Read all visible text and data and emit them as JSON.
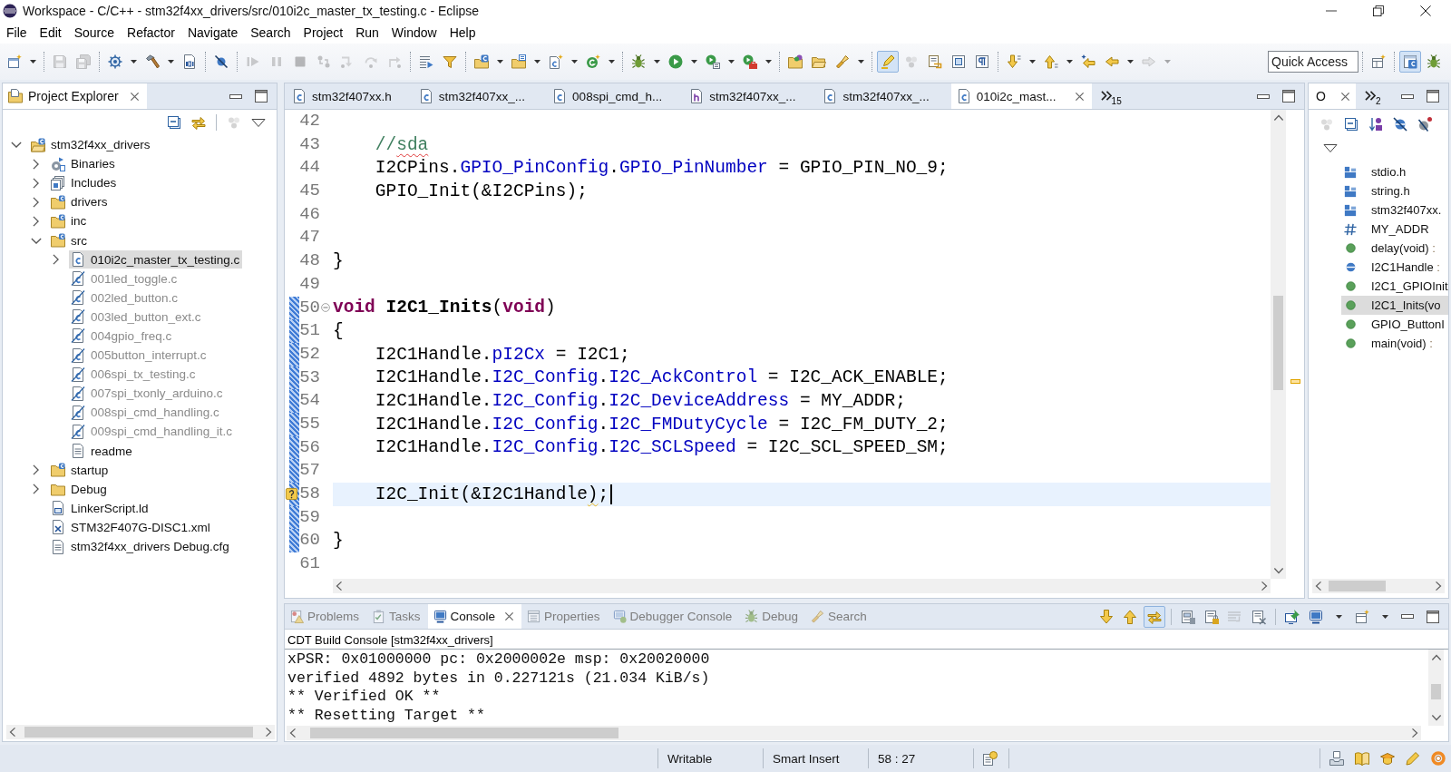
{
  "window": {
    "title": "Workspace - C/C++ - stm32f4xx_drivers/src/010i2c_master_tx_testing.c - Eclipse"
  },
  "menu": [
    "File",
    "Edit",
    "Source",
    "Refactor",
    "Navigate",
    "Search",
    "Project",
    "Run",
    "Window",
    "Help"
  ],
  "toolbar": {
    "groups": [
      [
        {
          "kind": "wizard",
          "dropdown": true,
          "disabled": false
        }
      ],
      [
        {
          "kind": "save",
          "disabled": true
        },
        {
          "kind": "saveall",
          "disabled": true
        }
      ],
      [
        {
          "kind": "buildconfig",
          "dropdown": true,
          "disabled": false
        },
        {
          "kind": "build",
          "dropdown": true,
          "disabled": false
        },
        {
          "kind": "binary",
          "disabled": false
        }
      ],
      [
        {
          "kind": "skip",
          "disabled": false
        }
      ],
      [
        {
          "kind": "resume",
          "disabled": true
        },
        {
          "kind": "suspend",
          "disabled": true
        },
        {
          "kind": "terminate",
          "disabled": true
        },
        {
          "kind": "disconnect",
          "disabled": true
        },
        {
          "kind": "stepinto",
          "disabled": true
        },
        {
          "kind": "stepover",
          "disabled": true
        },
        {
          "kind": "stepreturn",
          "disabled": true
        }
      ],
      [
        {
          "kind": "instrstep",
          "disabled": false
        },
        {
          "kind": "stepfilter",
          "disabled": false
        }
      ],
      [
        {
          "kind": "cproject",
          "dropdown": true,
          "disabled": false
        },
        {
          "kind": "sourcefolder",
          "dropdown": true,
          "disabled": false
        },
        {
          "kind": "cfile",
          "dropdown": true,
          "disabled": false
        },
        {
          "kind": "cclass",
          "dropdown": true,
          "disabled": false
        }
      ],
      [
        {
          "kind": "debug",
          "dropdown": true,
          "disabled": false
        },
        {
          "kind": "run",
          "dropdown": true,
          "disabled": false
        },
        {
          "kind": "runtools",
          "dropdown": true,
          "disabled": false
        },
        {
          "kind": "coverage",
          "dropdown": true,
          "disabled": false
        }
      ],
      [
        {
          "kind": "opentype",
          "disabled": false
        },
        {
          "kind": "openelement",
          "disabled": false
        },
        {
          "kind": "search",
          "dropdown": true,
          "disabled": false
        }
      ],
      [
        {
          "kind": "highlight",
          "disabled": false,
          "pressed": true
        },
        {
          "kind": "beads",
          "disabled": true
        },
        {
          "kind": "format",
          "disabled": false
        },
        {
          "kind": "blockselect",
          "disabled": false
        },
        {
          "kind": "whitespace",
          "disabled": false
        }
      ],
      [
        {
          "kind": "nextannotation",
          "dropdown": true,
          "disabled": false
        },
        {
          "kind": "prevannotation",
          "dropdown": true,
          "disabled": false
        },
        {
          "kind": "lastedit",
          "disabled": false
        },
        {
          "kind": "back",
          "dropdown": true,
          "disabled": false
        },
        {
          "kind": "forward",
          "dropdown": true,
          "disabled": true
        }
      ]
    ],
    "quick_access": {
      "placeholder": "Quick Access"
    },
    "perspectives": [
      {
        "kind": "cpp",
        "selected": true
      },
      {
        "kind": "debug",
        "selected": false
      }
    ]
  },
  "project_explorer": {
    "title": "Project Explorer",
    "toolbar": [
      [
        {
          "kind": "collapse",
          "disabled": false
        },
        {
          "kind": "link",
          "disabled": false
        }
      ],
      [
        {
          "kind": "group",
          "disabled": true
        },
        {
          "kind": "menu",
          "disabled": false
        }
      ]
    ],
    "tree": [
      {
        "label": "stm32f4xx_drivers",
        "kind": "project",
        "expanded": true,
        "selected": false,
        "children": [
          {
            "label": "Binaries",
            "kind": "binaries",
            "expanded": false,
            "selected": false
          },
          {
            "label": "Includes",
            "kind": "includes",
            "expanded": false,
            "selected": false
          },
          {
            "label": "drivers",
            "kind": "sourcefolder",
            "expanded": false,
            "selected": false
          },
          {
            "label": "inc",
            "kind": "sourcefolder",
            "expanded": false,
            "selected": false
          },
          {
            "label": "src",
            "kind": "sourcefolder",
            "expanded": true,
            "selected": false,
            "children": [
              {
                "label": "010i2c_master_tx_testing.c",
                "kind": "source",
                "expanded": false,
                "selected": true
              },
              {
                "label": "001led_toggle.c",
                "kind": "excluded",
                "selected": false
              },
              {
                "label": "002led_button.c",
                "kind": "excluded",
                "selected": false
              },
              {
                "label": "003led_button_ext.c",
                "kind": "excluded",
                "selected": false
              },
              {
                "label": "004gpio_freq.c",
                "kind": "excluded",
                "selected": false
              },
              {
                "label": "005button_interrupt.c",
                "kind": "excluded",
                "selected": false
              },
              {
                "label": "006spi_tx_testing.c",
                "kind": "excluded",
                "selected": false
              },
              {
                "label": "007spi_txonly_arduino.c",
                "kind": "excluded",
                "selected": false
              },
              {
                "label": "008spi_cmd_handling.c",
                "kind": "excluded",
                "selected": false
              },
              {
                "label": "009spi_cmd_handling_it.c",
                "kind": "excluded",
                "selected": false
              },
              {
                "label": "readme",
                "kind": "text",
                "selected": false
              }
            ]
          },
          {
            "label": "startup",
            "kind": "sourcefolder",
            "expanded": false,
            "selected": false
          },
          {
            "label": "Debug",
            "kind": "folder",
            "expanded": false,
            "selected": false
          },
          {
            "label": "LinkerScript.ld",
            "kind": "linker",
            "selected": false
          },
          {
            "label": "STM32F407G-DISC1.xml",
            "kind": "xml",
            "selected": false
          },
          {
            "label": "stm32f4xx_drivers Debug.cfg",
            "kind": "text",
            "selected": false
          }
        ]
      }
    ]
  },
  "editor": {
    "tabs": [
      {
        "label": "stm32f407xx.h",
        "kind": "c",
        "selected": false
      },
      {
        "label": "stm32f407xx_...",
        "kind": "c",
        "selected": false
      },
      {
        "label": "008spi_cmd_h...",
        "kind": "c",
        "selected": false
      },
      {
        "label": "stm32f407xx_...",
        "kind": "h",
        "selected": false
      },
      {
        "label": "stm32f407xx_...",
        "kind": "c",
        "selected": false
      },
      {
        "label": "010i2c_mast...",
        "kind": "c",
        "selected": true
      }
    ],
    "overflow_count": "15",
    "lines": [
      {
        "number": "42"
      },
      {
        "number": "43",
        "segments": [
          {
            "text": "    //",
            "kind": "comment"
          },
          {
            "text": "sda",
            "kind": "typo"
          }
        ]
      },
      {
        "number": "44",
        "segments": [
          {
            "text": "    I2CPins.",
            "kind": "plain"
          },
          {
            "text": "GPIO_PinConfig",
            "kind": "field"
          },
          {
            "text": ".",
            "kind": "plain"
          },
          {
            "text": "GPIO_PinNumber",
            "kind": "field"
          },
          {
            "text": " = GPIO_PIN_NO_9;",
            "kind": "plain"
          }
        ]
      },
      {
        "number": "45",
        "segments": [
          {
            "text": "    GPIO_Init(&I2CPins);",
            "kind": "plain"
          }
        ]
      },
      {
        "number": "46"
      },
      {
        "number": "47"
      },
      {
        "number": "48",
        "segments": [
          {
            "text": "}",
            "kind": "plain"
          }
        ]
      },
      {
        "number": "49"
      },
      {
        "number": "50",
        "changed": true,
        "folded": false,
        "segments": [
          {
            "text": "void",
            "kind": "keyword"
          },
          {
            "text": " I2C1_Inits",
            "kind": "declaration"
          },
          {
            "text": "(",
            "kind": "plain"
          },
          {
            "text": "void",
            "kind": "keyword"
          },
          {
            "text": ")",
            "kind": "plain"
          }
        ]
      },
      {
        "number": "51",
        "changed": true,
        "segments": [
          {
            "text": "{",
            "kind": "plain"
          }
        ]
      },
      {
        "number": "52",
        "changed": true,
        "segments": [
          {
            "text": "    I2C1Handle.",
            "kind": "plain"
          },
          {
            "text": "pI2Cx",
            "kind": "field"
          },
          {
            "text": " = I2C1;",
            "kind": "plain"
          }
        ]
      },
      {
        "number": "53",
        "changed": true,
        "segments": [
          {
            "text": "    I2C1Handle.",
            "kind": "plain"
          },
          {
            "text": "I2C_Config",
            "kind": "field"
          },
          {
            "text": ".",
            "kind": "plain"
          },
          {
            "text": "I2C_AckControl",
            "kind": "field"
          },
          {
            "text": " = I2C_ACK_ENABLE;",
            "kind": "plain"
          }
        ]
      },
      {
        "number": "54",
        "changed": true,
        "segments": [
          {
            "text": "    I2C1Handle.",
            "kind": "plain"
          },
          {
            "text": "I2C_Config",
            "kind": "field"
          },
          {
            "text": ".",
            "kind": "plain"
          },
          {
            "text": "I2C_DeviceAddress",
            "kind": "field"
          },
          {
            "text": " = MY_ADDR;",
            "kind": "plain"
          }
        ]
      },
      {
        "number": "55",
        "changed": true,
        "segments": [
          {
            "text": "    I2C1Handle.",
            "kind": "plain"
          },
          {
            "text": "I2C_Config",
            "kind": "field"
          },
          {
            "text": ".",
            "kind": "plain"
          },
          {
            "text": "I2C_FMDutyCycle",
            "kind": "field"
          },
          {
            "text": " = I2C_FM_DUTY_2;",
            "kind": "plain"
          }
        ]
      },
      {
        "number": "56",
        "changed": true,
        "segments": [
          {
            "text": "    I2C1Handle.",
            "kind": "plain"
          },
          {
            "text": "I2C_Config",
            "kind": "field"
          },
          {
            "text": ".",
            "kind": "plain"
          },
          {
            "text": "I2C_SCLSpeed",
            "kind": "field"
          },
          {
            "text": " = I2C_SCL_SPEED_SM;",
            "kind": "plain"
          }
        ]
      },
      {
        "number": "57",
        "changed": true
      },
      {
        "number": "58",
        "changed": true,
        "current": true,
        "warning": true,
        "segments": [
          {
            "text": "    I2C_Init(&I2C1Handle",
            "kind": "plain"
          },
          {
            "text": ")",
            "kind": "warning"
          },
          {
            "text": ";",
            "kind": "plain"
          }
        ]
      },
      {
        "number": "59",
        "changed": true
      },
      {
        "number": "60",
        "changed": true,
        "segments": [
          {
            "text": "}",
            "kind": "plain"
          }
        ]
      },
      {
        "number": "61"
      }
    ]
  },
  "outline": {
    "tab": "O",
    "overflow_count": "2",
    "toolbar": [
      {
        "kind": "group",
        "disabled": true
      },
      {
        "kind": "collapse",
        "disabled": false
      },
      {
        "kind": "sort",
        "disabled": false
      },
      {
        "kind": "hidefields",
        "disabled": false
      },
      {
        "kind": "hidestatic",
        "disabled": false
      },
      {
        "kind": "menu",
        "disabled": false
      }
    ],
    "items": [
      {
        "label": "stdio.h",
        "kind": "include",
        "selected": false
      },
      {
        "label": "string.h",
        "kind": "include",
        "selected": false
      },
      {
        "label": "stm32f407xx.",
        "kind": "include",
        "selected": false
      },
      {
        "label": "MY_ADDR",
        "kind": "macro",
        "selected": false
      },
      {
        "label": "delay(void)",
        "suffix": ":",
        "kind": "function",
        "selected": false
      },
      {
        "label": "I2C1Handle",
        "suffix": ":",
        "kind": "variable",
        "selected": false
      },
      {
        "label": "I2C1_GPIOInit",
        "kind": "function",
        "selected": false
      },
      {
        "label": "I2C1_Inits(vo",
        "kind": "function",
        "selected": true
      },
      {
        "label": "GPIO_ButtonI",
        "kind": "function",
        "selected": false
      },
      {
        "label": "main(void)",
        "suffix": ":",
        "kind": "function",
        "selected": false
      }
    ]
  },
  "bottom_panel": {
    "tabs": [
      {
        "label": "Problems",
        "kind": "problems",
        "selected": false
      },
      {
        "label": "Tasks",
        "kind": "tasks",
        "selected": false
      },
      {
        "label": "Console",
        "kind": "console",
        "selected": true
      },
      {
        "label": "Properties",
        "kind": "properties",
        "selected": false
      },
      {
        "label": "Debugger Console",
        "kind": "debuggerconsole",
        "selected": false
      },
      {
        "label": "Debug",
        "kind": "debug",
        "selected": false
      },
      {
        "label": "Search",
        "kind": "search",
        "selected": false
      }
    ],
    "toolbar": [
      [
        {
          "kind": "nexterror",
          "disabled": false
        },
        {
          "kind": "preverror",
          "disabled": false
        },
        {
          "kind": "showerror",
          "disabled": false,
          "pressed": true
        }
      ],
      [
        {
          "kind": "copylog",
          "disabled": false
        },
        {
          "kind": "scrolllock",
          "disabled": false
        },
        {
          "kind": "wordwrap",
          "disabled": true
        },
        {
          "kind": "clear",
          "disabled": false
        }
      ],
      [
        {
          "kind": "pin",
          "disabled": false
        },
        {
          "kind": "display",
          "disabled": false,
          "dropdown": true
        },
        {
          "kind": "open",
          "disabled": false,
          "dropdown": true
        }
      ]
    ],
    "console": {
      "title": "CDT Build Console [stm32f4xx_drivers]",
      "lines": [
        "xPSR: 0x01000000 pc: 0x2000002e msp: 0x20020000",
        "verified 4892 bytes in 0.227121s (21.034 KiB/s)",
        "** Verified OK **",
        "** Resetting Target **"
      ]
    }
  },
  "status_bar": {
    "fields": [
      "Writable",
      "Smart Insert",
      "58 : 27"
    ]
  }
}
